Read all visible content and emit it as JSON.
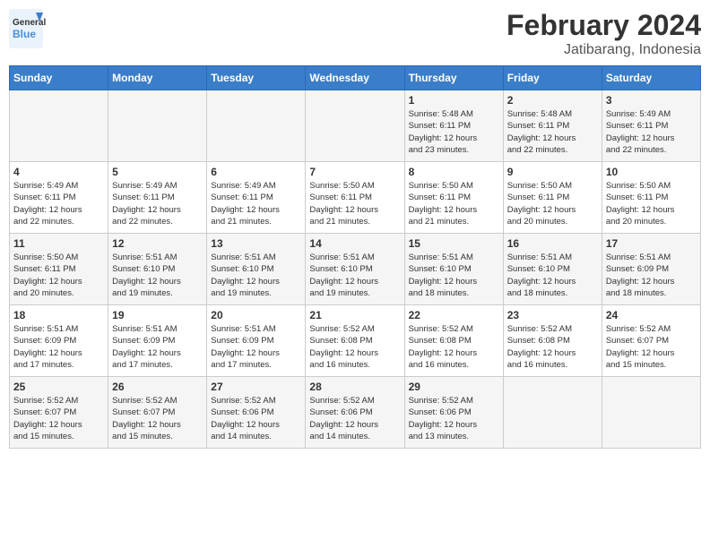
{
  "logo": {
    "text_general": "General",
    "text_blue": "Blue"
  },
  "title": "February 2024",
  "subtitle": "Jatibarang, Indonesia",
  "days_of_week": [
    "Sunday",
    "Monday",
    "Tuesday",
    "Wednesday",
    "Thursday",
    "Friday",
    "Saturday"
  ],
  "weeks": [
    [
      {
        "day": "",
        "info": ""
      },
      {
        "day": "",
        "info": ""
      },
      {
        "day": "",
        "info": ""
      },
      {
        "day": "",
        "info": ""
      },
      {
        "day": "1",
        "info": "Sunrise: 5:48 AM\nSunset: 6:11 PM\nDaylight: 12 hours\nand 23 minutes."
      },
      {
        "day": "2",
        "info": "Sunrise: 5:48 AM\nSunset: 6:11 PM\nDaylight: 12 hours\nand 22 minutes."
      },
      {
        "day": "3",
        "info": "Sunrise: 5:49 AM\nSunset: 6:11 PM\nDaylight: 12 hours\nand 22 minutes."
      }
    ],
    [
      {
        "day": "4",
        "info": "Sunrise: 5:49 AM\nSunset: 6:11 PM\nDaylight: 12 hours\nand 22 minutes."
      },
      {
        "day": "5",
        "info": "Sunrise: 5:49 AM\nSunset: 6:11 PM\nDaylight: 12 hours\nand 22 minutes."
      },
      {
        "day": "6",
        "info": "Sunrise: 5:49 AM\nSunset: 6:11 PM\nDaylight: 12 hours\nand 21 minutes."
      },
      {
        "day": "7",
        "info": "Sunrise: 5:50 AM\nSunset: 6:11 PM\nDaylight: 12 hours\nand 21 minutes."
      },
      {
        "day": "8",
        "info": "Sunrise: 5:50 AM\nSunset: 6:11 PM\nDaylight: 12 hours\nand 21 minutes."
      },
      {
        "day": "9",
        "info": "Sunrise: 5:50 AM\nSunset: 6:11 PM\nDaylight: 12 hours\nand 20 minutes."
      },
      {
        "day": "10",
        "info": "Sunrise: 5:50 AM\nSunset: 6:11 PM\nDaylight: 12 hours\nand 20 minutes."
      }
    ],
    [
      {
        "day": "11",
        "info": "Sunrise: 5:50 AM\nSunset: 6:11 PM\nDaylight: 12 hours\nand 20 minutes."
      },
      {
        "day": "12",
        "info": "Sunrise: 5:51 AM\nSunset: 6:10 PM\nDaylight: 12 hours\nand 19 minutes."
      },
      {
        "day": "13",
        "info": "Sunrise: 5:51 AM\nSunset: 6:10 PM\nDaylight: 12 hours\nand 19 minutes."
      },
      {
        "day": "14",
        "info": "Sunrise: 5:51 AM\nSunset: 6:10 PM\nDaylight: 12 hours\nand 19 minutes."
      },
      {
        "day": "15",
        "info": "Sunrise: 5:51 AM\nSunset: 6:10 PM\nDaylight: 12 hours\nand 18 minutes."
      },
      {
        "day": "16",
        "info": "Sunrise: 5:51 AM\nSunset: 6:10 PM\nDaylight: 12 hours\nand 18 minutes."
      },
      {
        "day": "17",
        "info": "Sunrise: 5:51 AM\nSunset: 6:09 PM\nDaylight: 12 hours\nand 18 minutes."
      }
    ],
    [
      {
        "day": "18",
        "info": "Sunrise: 5:51 AM\nSunset: 6:09 PM\nDaylight: 12 hours\nand 17 minutes."
      },
      {
        "day": "19",
        "info": "Sunrise: 5:51 AM\nSunset: 6:09 PM\nDaylight: 12 hours\nand 17 minutes."
      },
      {
        "day": "20",
        "info": "Sunrise: 5:51 AM\nSunset: 6:09 PM\nDaylight: 12 hours\nand 17 minutes."
      },
      {
        "day": "21",
        "info": "Sunrise: 5:52 AM\nSunset: 6:08 PM\nDaylight: 12 hours\nand 16 minutes."
      },
      {
        "day": "22",
        "info": "Sunrise: 5:52 AM\nSunset: 6:08 PM\nDaylight: 12 hours\nand 16 minutes."
      },
      {
        "day": "23",
        "info": "Sunrise: 5:52 AM\nSunset: 6:08 PM\nDaylight: 12 hours\nand 16 minutes."
      },
      {
        "day": "24",
        "info": "Sunrise: 5:52 AM\nSunset: 6:07 PM\nDaylight: 12 hours\nand 15 minutes."
      }
    ],
    [
      {
        "day": "25",
        "info": "Sunrise: 5:52 AM\nSunset: 6:07 PM\nDaylight: 12 hours\nand 15 minutes."
      },
      {
        "day": "26",
        "info": "Sunrise: 5:52 AM\nSunset: 6:07 PM\nDaylight: 12 hours\nand 15 minutes."
      },
      {
        "day": "27",
        "info": "Sunrise: 5:52 AM\nSunset: 6:06 PM\nDaylight: 12 hours\nand 14 minutes."
      },
      {
        "day": "28",
        "info": "Sunrise: 5:52 AM\nSunset: 6:06 PM\nDaylight: 12 hours\nand 14 minutes."
      },
      {
        "day": "29",
        "info": "Sunrise: 5:52 AM\nSunset: 6:06 PM\nDaylight: 12 hours\nand 13 minutes."
      },
      {
        "day": "",
        "info": ""
      },
      {
        "day": "",
        "info": ""
      }
    ]
  ]
}
